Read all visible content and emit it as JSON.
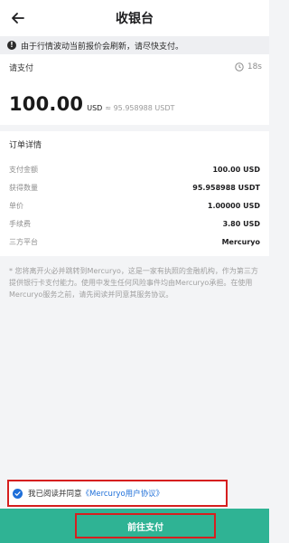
{
  "header": {
    "title": "收银台",
    "back_icon": "arrow-left-icon"
  },
  "notice": {
    "text": "由于行情波动当前报价会刷新，请尽快支付。",
    "icon": "exclamation-icon"
  },
  "payment": {
    "label": "请支付",
    "timer_icon": "clock-icon",
    "timer": "18s",
    "amount": "100.00",
    "currency": "USD",
    "equivalent": "≈ 95.958988 USDT"
  },
  "order": {
    "title": "订单详情",
    "rows": [
      {
        "label": "支付金额",
        "value": "100.00 USD"
      },
      {
        "label": "获得数量",
        "value": "95.958988 USDT"
      },
      {
        "label": "单价",
        "value": "1.00000 USD"
      },
      {
        "label": "手续费",
        "value": "3.80 USD"
      },
      {
        "label": "三方平台",
        "value": "Mercuryo"
      }
    ]
  },
  "disclaimer": "* 您将离开火必并跳转到Mercuryo，这是一家有执照的金融机构，作为第三方提供银行卡支付能力。使用中发生任何风险事件均由Mercuryo承担。在使用Mercuryo服务之前，请先阅读并同意其服务协议。",
  "agreement": {
    "checked": true,
    "check_icon": "check-circle-icon",
    "text": "我已阅读并同意",
    "link": "《Mercuryo用户协议》"
  },
  "footer": {
    "button_label": "前往支付"
  },
  "colors": {
    "accent": "#2fb394",
    "link": "#1e6fd9",
    "highlight": "#d61f1f"
  }
}
